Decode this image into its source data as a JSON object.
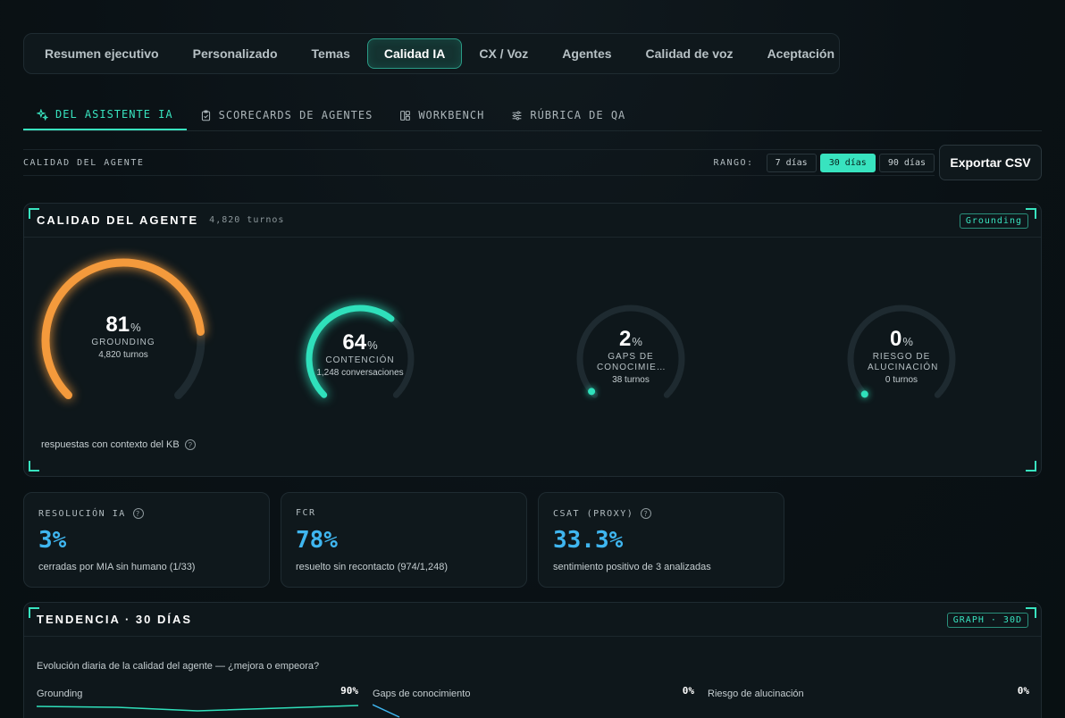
{
  "top_tabs": [
    {
      "label": "Resumen ejecutivo",
      "active": false
    },
    {
      "label": "Personalizado",
      "active": false
    },
    {
      "label": "Temas",
      "active": false
    },
    {
      "label": "Calidad IA",
      "active": true
    },
    {
      "label": "CX / Voz",
      "active": false
    },
    {
      "label": "Agentes",
      "active": false
    },
    {
      "label": "Calidad de voz",
      "active": false
    },
    {
      "label": "Aceptación",
      "active": false
    }
  ],
  "sub_tabs": [
    {
      "label": "DEL ASISTENTE IA",
      "icon": "sparkle-icon",
      "active": true
    },
    {
      "label": "SCORECARDS DE AGENTES",
      "icon": "clipboard-check-icon",
      "active": false
    },
    {
      "label": "WORKBENCH",
      "icon": "layout-icon",
      "active": false
    },
    {
      "label": "RÚBRICA DE QA",
      "icon": "sliders-icon",
      "active": false
    }
  ],
  "toolbar": {
    "title": "CALIDAD DEL AGENTE",
    "range_label": "RANGO:",
    "ranges": [
      {
        "label": "7 días",
        "active": false
      },
      {
        "label": "30 días",
        "active": true
      },
      {
        "label": "90 días",
        "active": false
      }
    ],
    "export_label": "Exportar CSV"
  },
  "quality_panel": {
    "title": "CALIDAD DEL AGENTE",
    "subtitle": "4,820 turnos",
    "badge": "Grounding",
    "note": "respuestas con contexto del KB",
    "gauges": [
      {
        "value": "81",
        "unit": "%",
        "label": "GROUNDING",
        "sub": "4,820 turnos",
        "fraction": 0.81,
        "color": "#f49a3c"
      },
      {
        "value": "64",
        "unit": "%",
        "label": "CONTENCIÓN",
        "sub": "1,248 conversaciones",
        "fraction": 0.64,
        "color": "#2fe0bb"
      },
      {
        "value": "2",
        "unit": "%",
        "label": "GAPS DE CONOCIMIE…",
        "sub": "38 turnos",
        "fraction": 0.02,
        "color": "#2fe0bb"
      },
      {
        "value": "0",
        "unit": "%",
        "label": "RIESGO DE ALUCINACIÓN",
        "sub": "0 turnos",
        "fraction": 0.0,
        "color": "#2fe0bb"
      }
    ]
  },
  "kpis": [
    {
      "label": "RESOLUCIÓN IA",
      "help": true,
      "value": "3%",
      "sub": "cerradas por MIA sin humano (1/33)"
    },
    {
      "label": "FCR",
      "help": false,
      "value": "78%",
      "sub": "resuelto sin recontacto (974/1,248)"
    },
    {
      "label": "CSAT (PROXY)",
      "help": true,
      "value": "33.3%",
      "sub": "sentimiento positivo de 3 analizadas"
    }
  ],
  "trend_panel": {
    "title": "TENDENCIA · 30 DÍAS",
    "badge": "GRAPH · 30D",
    "description": "Evolución diaria de la calidad del agente — ¿mejora o empeora?",
    "series": [
      {
        "name": "Grounding",
        "value": "90%"
      },
      {
        "name": "Gaps de conocimiento",
        "value": "0%"
      },
      {
        "name": "Riesgo de alucinación",
        "value": "0%"
      }
    ]
  },
  "colors": {
    "accent": "#38e3bf",
    "orange": "#f49a3c",
    "kpi_blue": "#3fb6f0"
  }
}
